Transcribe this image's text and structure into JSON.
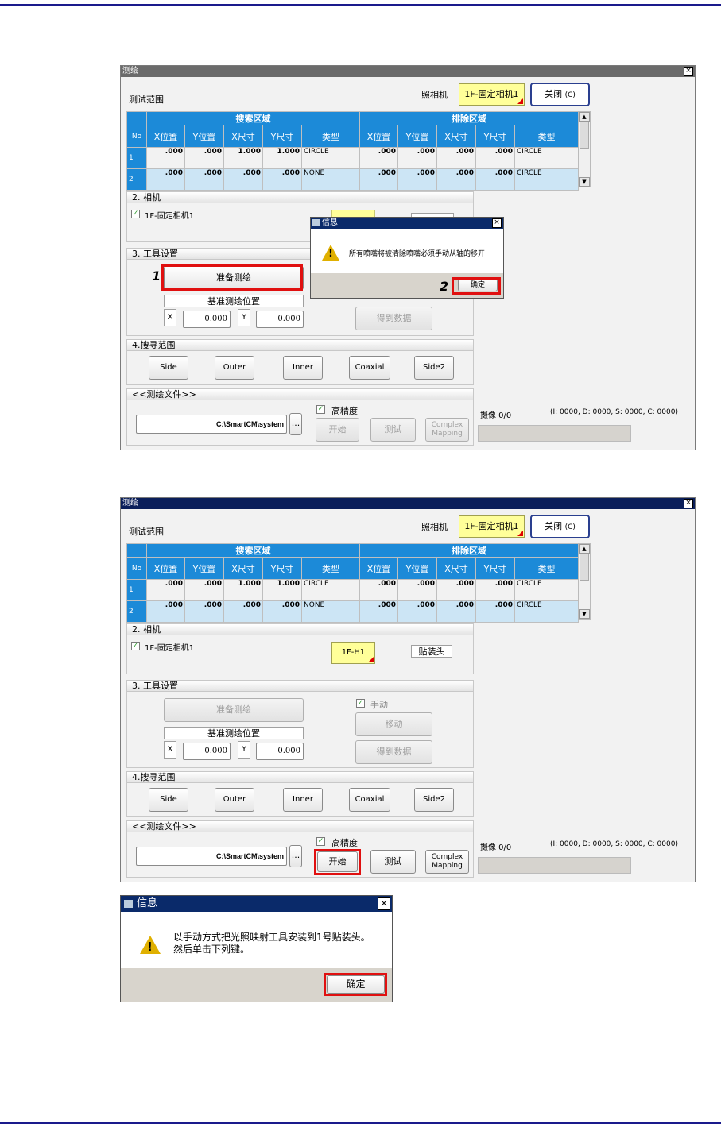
{
  "window_title": "测绘",
  "close_x": "×",
  "test_range_label": "测试范围",
  "camera_label": "照相机",
  "camera_select": "1F-固定相机1",
  "close_button": "关闭",
  "close_shortcut": "(C)",
  "table": {
    "group_search": "搜索区域",
    "group_exclude": "排除区域",
    "columns": [
      "No",
      "X位置",
      "Y位置",
      "X尺寸",
      "Y尺寸",
      "类型",
      "X位置",
      "Y位置",
      "X尺寸",
      "Y尺寸",
      "类型"
    ],
    "rows": [
      [
        "1",
        ".000",
        ".000",
        "1.000",
        "1.000",
        "CIRCLE",
        ".000",
        ".000",
        ".000",
        ".000",
        "CIRCLE"
      ],
      [
        "2",
        ".000",
        ".000",
        ".000",
        ".000",
        "NONE",
        ".000",
        ".000",
        ".000",
        ".000",
        "CIRCLE"
      ]
    ]
  },
  "sec_camera": "2. 相机",
  "camera_check_label": "1F-固定相机1",
  "head_select": "1F-H1",
  "head_label": "贴装头",
  "sec_tool": "3. 工具设置",
  "prepare_button": "准备测绘",
  "base_position_label": "基准测绘位置",
  "x_label": "X",
  "y_label": "Y",
  "x_value": "0.000",
  "y_value": "0.000",
  "manual_label": "手动",
  "move_button": "移动",
  "get_data_button": "得到数据",
  "sec_search": "4.搜寻范围",
  "search_buttons": [
    "Side",
    "Outer",
    "Inner",
    "Coaxial",
    "Side2"
  ],
  "sec_file": "<<测绘文件>>",
  "file_path": "C:\\SmartCM\\system",
  "browse_button": "...",
  "high_precision_label": "高精度",
  "start_button": "开始",
  "test_button": "测试",
  "complex_button_line1": "Complex",
  "complex_button_line2": "Mapping",
  "capture_label": "摄像 0/0",
  "status_counts": "(I: 0000, D: 0000, S: 0000, C: 0000)",
  "dialog1": {
    "title": "信息",
    "message": "所有喷嘴将被清除喷嘴必须手动从轴的移开",
    "ok": "确定"
  },
  "dialog2": {
    "title": "信息",
    "message_line1": "以手动方式把光照映射工具安装到1号贴装头。",
    "message_line2": "然后单击下列键。",
    "ok": "确定"
  },
  "annotations": {
    "step1": "1",
    "step2": "2"
  },
  "colors": {
    "title_bar_1": "#6b6b6b",
    "title_bar_2": "#0a1e5a",
    "table_header": "#1c8ad8",
    "highlight_red": "#e01010",
    "rule_blue": "#1a1a8c"
  }
}
